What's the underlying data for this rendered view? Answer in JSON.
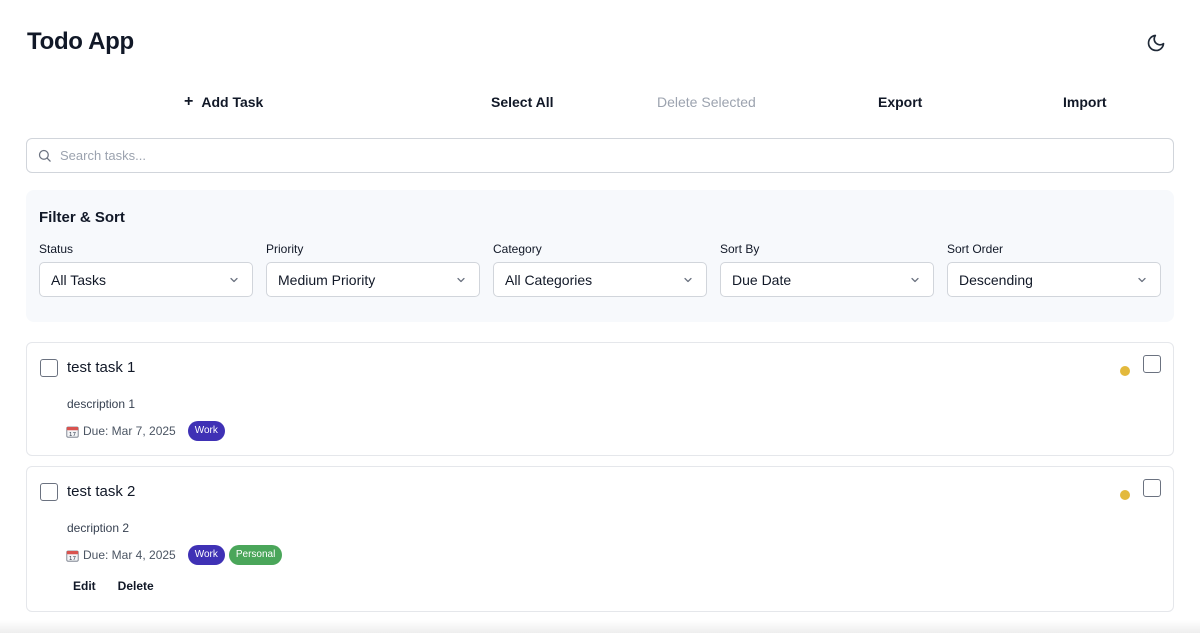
{
  "app": {
    "title": "Todo App",
    "theme_toggle_icon": "moon-icon"
  },
  "toolbar": {
    "add_task_icon": "plus-icon",
    "add_task": "Add Task",
    "select_all": "Select All",
    "delete_selected": "Delete Selected",
    "export": "Export",
    "import": "Import"
  },
  "search": {
    "placeholder": "Search tasks...",
    "value": "",
    "icon": "search-icon"
  },
  "filters": {
    "title": "Filter & Sort",
    "status": {
      "label": "Status",
      "value": "All Tasks"
    },
    "priority": {
      "label": "Priority",
      "value": "Medium Priority"
    },
    "category": {
      "label": "Category",
      "value": "All Categories"
    },
    "sort_by": {
      "label": "Sort By",
      "value": "Due Date"
    },
    "sort_order": {
      "label": "Sort Order",
      "value": "Descending"
    }
  },
  "tasks": [
    {
      "title": "test task 1",
      "description": "description 1",
      "due": "Due: Mar 7, 2025",
      "priority_color": "#e3b93c",
      "tags": [
        {
          "label": "Work",
          "color": "#3f31b5"
        }
      ]
    },
    {
      "title": "test task 2",
      "description": "decription 2",
      "due": "Due: Mar 4, 2025",
      "priority_color": "#e3b93c",
      "tags": [
        {
          "label": "Work",
          "color": "#3f31b5"
        },
        {
          "label": "Personal",
          "color": "#4aa65a"
        }
      ],
      "actions": {
        "edit": "Edit",
        "delete": "Delete"
      }
    }
  ]
}
